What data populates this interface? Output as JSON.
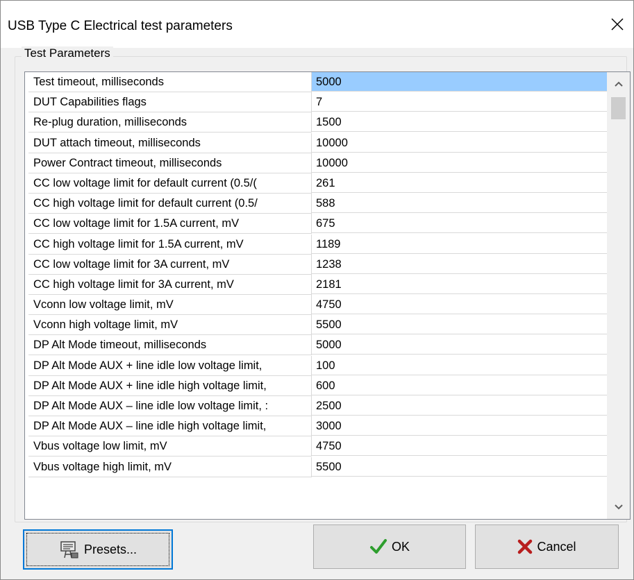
{
  "window": {
    "title": "USB Type C Electrical test parameters"
  },
  "group": {
    "label": "Test Parameters"
  },
  "params": [
    {
      "label": "Test timeout, milliseconds",
      "value": "5000"
    },
    {
      "label": "DUT Capabilities flags",
      "value": "7"
    },
    {
      "label": "Re-plug duration, milliseconds",
      "value": "1500"
    },
    {
      "label": "DUT attach timeout, milliseconds",
      "value": "10000"
    },
    {
      "label": "Power Contract timeout, milliseconds",
      "value": "10000"
    },
    {
      "label": "CC low voltage limit for default current (0.5/(",
      "value": "261"
    },
    {
      "label": "CC high voltage limit for default current (0.5/",
      "value": "588"
    },
    {
      "label": "CC low voltage limit for 1.5A current, mV",
      "value": "675"
    },
    {
      "label": "CC high voltage limit for 1.5A current, mV",
      "value": "1189"
    },
    {
      "label": "CC low voltage limit for 3A current, mV",
      "value": "1238"
    },
    {
      "label": "CC high voltage limit for 3A current, mV",
      "value": "2181"
    },
    {
      "label": "Vconn low voltage limit, mV",
      "value": "4750"
    },
    {
      "label": "Vconn high voltage limit, mV",
      "value": "5500"
    },
    {
      "label": "DP Alt Mode timeout, milliseconds",
      "value": "5000"
    },
    {
      "label": "DP Alt Mode AUX + line idle low voltage limit,",
      "value": "100"
    },
    {
      "label": "DP Alt Mode AUX + line idle high voltage limit,",
      "value": "600"
    },
    {
      "label": "DP Alt Mode AUX – line idle low voltage limit, :",
      "value": "2500"
    },
    {
      "label": "DP Alt Mode AUX – line idle high voltage limit,",
      "value": "3000"
    },
    {
      "label": "Vbus voltage low limit, mV",
      "value": "4750"
    },
    {
      "label": "Vbus voltage high limit, mV",
      "value": "5500"
    }
  ],
  "selected_index": 0,
  "buttons": {
    "presets": "Presets...",
    "ok": "OK",
    "cancel": "Cancel"
  },
  "icons": {
    "close": "close-icon",
    "presets": "presets-icon",
    "ok": "checkmark-icon",
    "cancel": "cross-icon",
    "scroll_up": "chevron-up-icon",
    "scroll_down": "chevron-down-icon"
  },
  "colors": {
    "selection": "#99ccff",
    "ok_check": "#2e9e2e",
    "cancel_cross": "#b81d1d",
    "focus": "#0078d7"
  }
}
